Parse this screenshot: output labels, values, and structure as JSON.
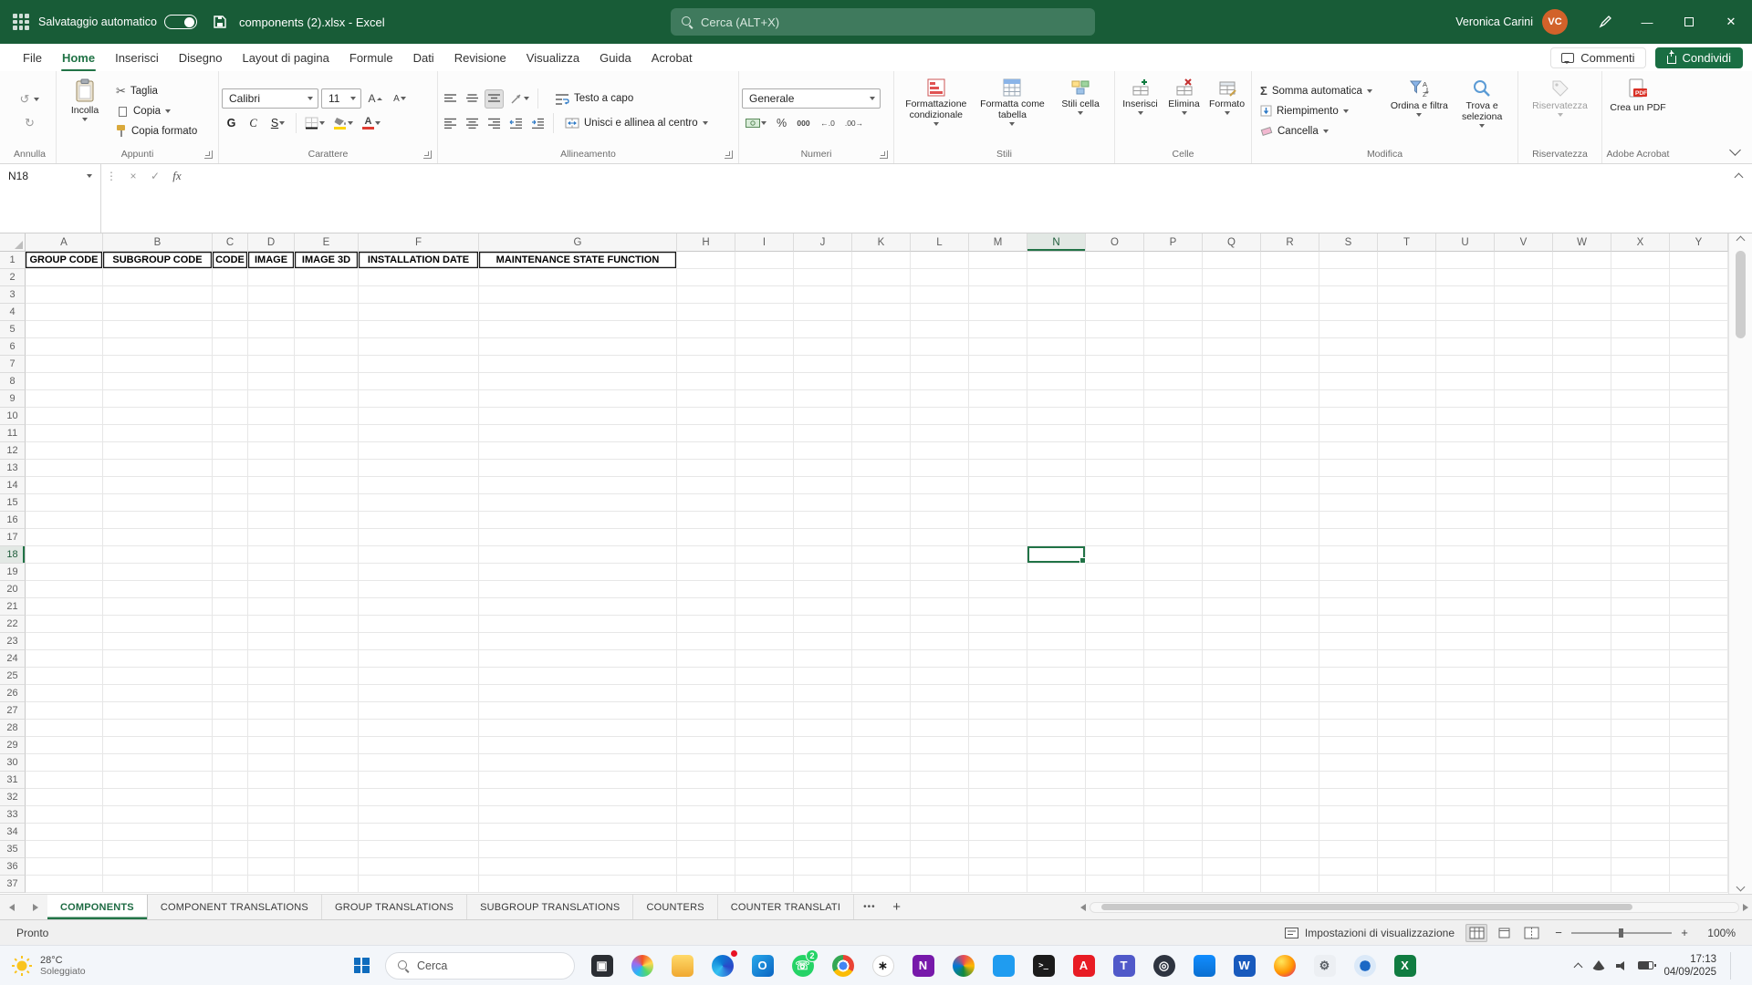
{
  "titlebar": {
    "autosave_label": "Salvataggio automatico",
    "doc_title": "components (2).xlsx  -  Excel",
    "search_placeholder": "Cerca (ALT+X)",
    "user_name": "Veronica Carini",
    "user_initials": "VC"
  },
  "menubar": {
    "tabs": [
      "File",
      "Home",
      "Inserisci",
      "Disegno",
      "Layout di pagina",
      "Formule",
      "Dati",
      "Revisione",
      "Visualizza",
      "Guida",
      "Acrobat"
    ],
    "active": "Home",
    "comments_label": "Commenti",
    "share_label": "Condividi"
  },
  "ribbon": {
    "undo": {
      "label": "Annulla"
    },
    "clipboard": {
      "paste": "Incolla",
      "cut": "Taglia",
      "copy": "Copia",
      "painter": "Copia formato",
      "label": "Appunti"
    },
    "font": {
      "family": "Calibri",
      "size": "11",
      "bold": "G",
      "italic": "C",
      "underline": "S",
      "label": "Carattere"
    },
    "alignment": {
      "wrap": "Testo a capo",
      "merge": "Unisci e allinea al centro",
      "label": "Allineamento"
    },
    "number": {
      "format": "Generale",
      "thousands": "000",
      "label": "Numeri"
    },
    "styles": {
      "conditional": "Formattazione condizionale",
      "format_table": "Formatta come tabella",
      "cell_styles": "Stili cella",
      "label": "Stili"
    },
    "cells": {
      "insert": "Inserisci",
      "delete": "Elimina",
      "format": "Formato",
      "label": "Celle"
    },
    "editing": {
      "autosum": "Somma automatica",
      "fill": "Riempimento",
      "clear": "Cancella",
      "sort": "Ordina e filtra",
      "find": "Trova e seleziona",
      "label": "Modifica"
    },
    "sensitivity": {
      "button": "Riservatezza",
      "label": "Riservatezza"
    },
    "acrobat": {
      "button": "Crea un PDF",
      "label": "Adobe Acrobat"
    }
  },
  "formula_bar": {
    "name_box": "N18"
  },
  "grid": {
    "columns": [
      "A",
      "B",
      "C",
      "D",
      "E",
      "F",
      "G",
      "H",
      "I",
      "J",
      "K",
      "L",
      "M",
      "N",
      "O",
      "P",
      "Q",
      "R",
      "S",
      "T",
      "U",
      "V",
      "W",
      "X",
      "Y"
    ],
    "row_count": 37,
    "header_row": [
      "GROUP CODE",
      "SUBGROUP CODE",
      "CODE",
      "IMAGE",
      "IMAGE 3D",
      "INSTALLATION DATE",
      "MAINTENANCE STATE FUNCTION"
    ],
    "selected_cell": "N18",
    "accent_color": "#217346"
  },
  "sheet_tabs": {
    "tabs": [
      "COMPONENTS",
      "COMPONENT TRANSLATIONS",
      "GROUP TRANSLATIONS",
      "SUBGROUP TRANSLATIONS",
      "COUNTERS",
      "COUNTER TRANSLATI"
    ],
    "active": "COMPONENTS"
  },
  "status_bar": {
    "ready": "Pronto",
    "display_settings": "Impostazioni di visualizzazione",
    "zoom": "100%"
  },
  "taskbar": {
    "weather": {
      "temp": "28°C",
      "desc": "Soleggiato"
    },
    "search": "Cerca",
    "clock": {
      "time": "17:13",
      "date": "04/09/2025"
    },
    "apps": [
      {
        "name": "task-view",
        "shape": "square",
        "bg": "#2b2e33",
        "glyph": "▣",
        "fg": "#ffffff"
      },
      {
        "name": "copilot",
        "shape": "circle",
        "bg": "conic-gradient(#f35325,#ffd84d,#53d86a,#29b6f6,#9a6cf0,#f35325)"
      },
      {
        "name": "file-explorer",
        "shape": "square",
        "bg": "linear-gradient(180deg,#ffd969,#f0a830)"
      },
      {
        "name": "edge",
        "shape": "circle",
        "bg": "conic-gradient(from 220deg,#35c1f1,#0b7bd4,#2a47c9,#35c1f1)",
        "dot": true
      },
      {
        "name": "outlook",
        "shape": "square",
        "bg": "linear-gradient(135deg,#28a8ea,#0a64c2)",
        "glyph": "O",
        "fg": "#ffffff"
      },
      {
        "name": "whatsapp",
        "shape": "circle",
        "bg": "#25d366",
        "glyph": "☏",
        "fg": "#ffffff",
        "badge": "2",
        "badge_color": "#25d366"
      },
      {
        "name": "chrome",
        "shape": "circle",
        "bg": "radial-gradient(circle,#4285f4 0 26%,#ffffff 26% 38%,rgba(255,255,255,0) 38%),conic-gradient(#ea4335 0 120deg,#fbbc05 120deg 240deg,#34a853 240deg 360deg)"
      },
      {
        "name": "chatgpt",
        "shape": "circle",
        "bg": "#ffffff",
        "glyph": "∗",
        "fg": "#1a1a1a",
        "border": "#d8d8d8"
      },
      {
        "name": "onenote",
        "shape": "square",
        "bg": "#7719aa",
        "glyph": "N",
        "fg": "#ffffff"
      },
      {
        "name": "photos",
        "shape": "circle",
        "bg": "conic-gradient(#e74856,#ffb900,#10893e,#0078d7,#e74856)"
      },
      {
        "name": "vscode",
        "shape": "square",
        "bg": "#1f9cf0"
      },
      {
        "name": "terminal",
        "shape": "square",
        "bg": "#1b1b1b",
        "glyph": ">_",
        "fg": "#ffffff",
        "mono": true
      },
      {
        "name": "acrobat",
        "shape": "square",
        "bg": "#e81c24",
        "glyph": "A",
        "fg": "#ffffff"
      },
      {
        "name": "teams",
        "shape": "square",
        "bg": "#5059c9",
        "glyph": "T",
        "fg": "#ffffff"
      },
      {
        "name": "obs",
        "shape": "circle",
        "bg": "#2e3440",
        "glyph": "◎",
        "fg": "#ffffff"
      },
      {
        "name": "power-bi",
        "shape": "square",
        "bg": "linear-gradient(180deg,#118dff,#0a6fd0)"
      },
      {
        "name": "word",
        "shape": "square",
        "bg": "#185abd",
        "glyph": "W",
        "fg": "#ffffff"
      },
      {
        "name": "firefox",
        "shape": "circle",
        "bg": "radial-gradient(circle at 35% 30%,#ffe75c,#ff9500 55%,#e3306e 90%)"
      },
      {
        "name": "settings",
        "shape": "square",
        "bg": "#eceff3",
        "glyph": "⚙",
        "fg": "#5b6066"
      },
      {
        "name": "camera",
        "shape": "circle",
        "bg": "radial-gradient(circle,#1b68c5 0 34%,#dbe9f8 34%)"
      },
      {
        "name": "excel",
        "shape": "square",
        "bg": "#107c41",
        "glyph": "X",
        "fg": "#ffffff"
      }
    ]
  }
}
